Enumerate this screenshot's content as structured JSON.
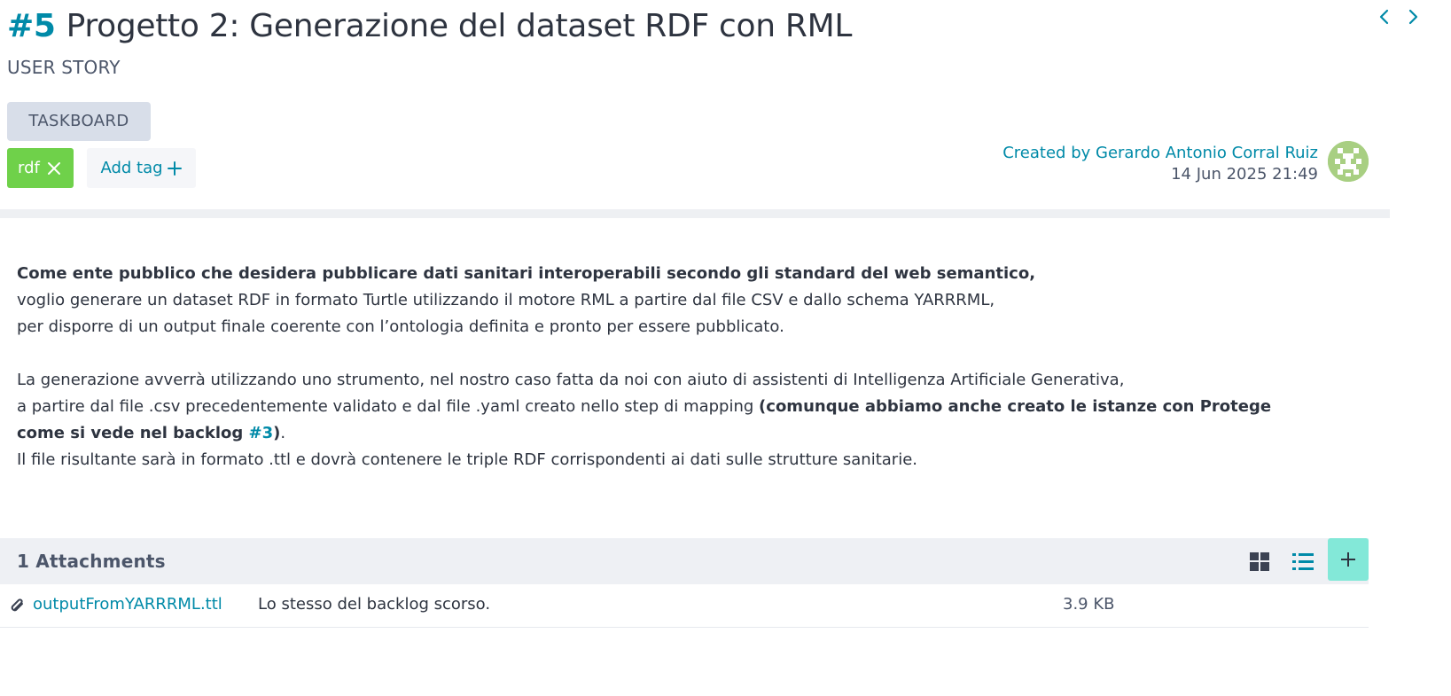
{
  "story": {
    "ref": "#5",
    "title": "Progetto 2: Generazione del dataset RDF con RML",
    "type_label": "USER STORY"
  },
  "navigation": {
    "prev_icon": "chevron-left-icon",
    "next_icon": "chevron-right-icon"
  },
  "taskboard": {
    "label": "TASKBOARD"
  },
  "tags": [
    {
      "name": "rdf",
      "color": "#6fd14a"
    }
  ],
  "add_tag": {
    "label": "Add tag"
  },
  "created": {
    "by_label": "Created by Gerardo Antonio Corral Ruiz",
    "date": "14 Jun 2025 21:49"
  },
  "description": {
    "p1_bold": "Come ente pubblico che desidera pubblicare dati sanitari interoperabili secondo gli standard del web semantico,",
    "p1_line2": "voglio generare un dataset RDF in formato Turtle utilizzando il motore RML a partire dal file CSV e dallo schema YARRRML,",
    "p1_line3": "per disporre di un output finale coerente con l’ontologia definita e pronto per essere pubblicato.",
    "p2_line1": "La generazione avverrà utilizzando uno strumento, nel nostro caso fatta da noi con aiuto di assistenti di Intelligenza Artificiale Generativa,",
    "p2_line2_plain": "a partire dal file .csv precedentemente validato e dal file .yaml creato nello step di mapping ",
    "p2_line2_bold": "(comunque abbiamo anche creato le istanze con Protege come si vede nel backlog ",
    "p2_link": "#3",
    "p2_bold_close": ")",
    "p2_period": ".",
    "p2_line3": "Il file risultante sarà in formato .ttl e dovrà contenere le triple RDF corrispondenti ai dati sulle strutture sanitarie."
  },
  "attachments": {
    "header": "1 Attachments",
    "accent": "#83e8d8",
    "items": [
      {
        "name": "outputFromYARRRML.ttl",
        "description": "Lo stesso del backlog scorso.",
        "size": "3.9 KB"
      }
    ]
  },
  "colors": {
    "link": "#008aa8",
    "tag_green": "#6fd14a",
    "add_attachment": "#83e8d8"
  }
}
